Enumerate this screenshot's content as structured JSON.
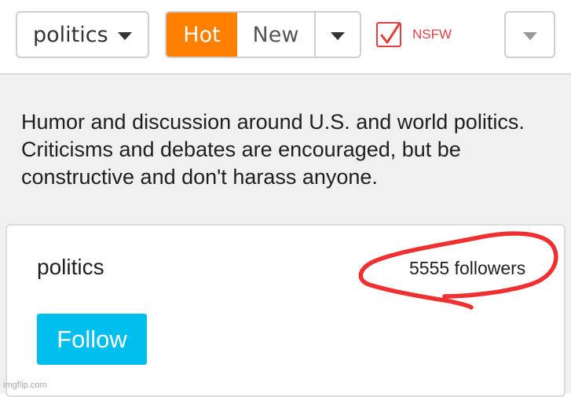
{
  "toolbar": {
    "category": "politics",
    "sort_hot": "Hot",
    "sort_new": "New",
    "nsfw_label": "NSFW"
  },
  "stream": {
    "description": "Humor and discussion around U.S. and world politics. Criticisms and debates are encouraged, but be constructive and don't harass anyone.",
    "name": "politics",
    "followers": "5555 followers",
    "follow_label": "Follow"
  },
  "watermark": "imgflip.com",
  "colors": {
    "hot_orange": "#ff7f00",
    "follow_blue": "#00bfee",
    "nsfw_red": "#e04040",
    "annotation_red": "#f03030"
  },
  "icons": {
    "caret": "chevron-down-icon",
    "check": "checkmark-icon"
  }
}
